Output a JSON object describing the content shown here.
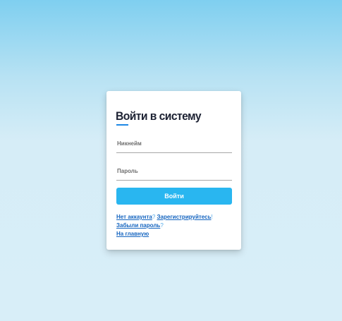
{
  "login_form": {
    "title": "Войти в систему",
    "username_placeholder": "Никнейм",
    "password_placeholder": "Пароль",
    "submit_label": "Войти",
    "no_account_text": "Нет аккаунта",
    "no_account_sep": "?",
    "register_link": "Зарегистрируйтесь",
    "register_suffix": "!",
    "forgot_password_link": "Забыли пароль",
    "forgot_password_suffix": "?",
    "home_link": "На главную"
  },
  "colors": {
    "accent": "#29b6f0",
    "link": "#1565c0",
    "title": "#1d2233",
    "background_top": "#7fcff0",
    "background_bottom": "#d8eef8"
  }
}
